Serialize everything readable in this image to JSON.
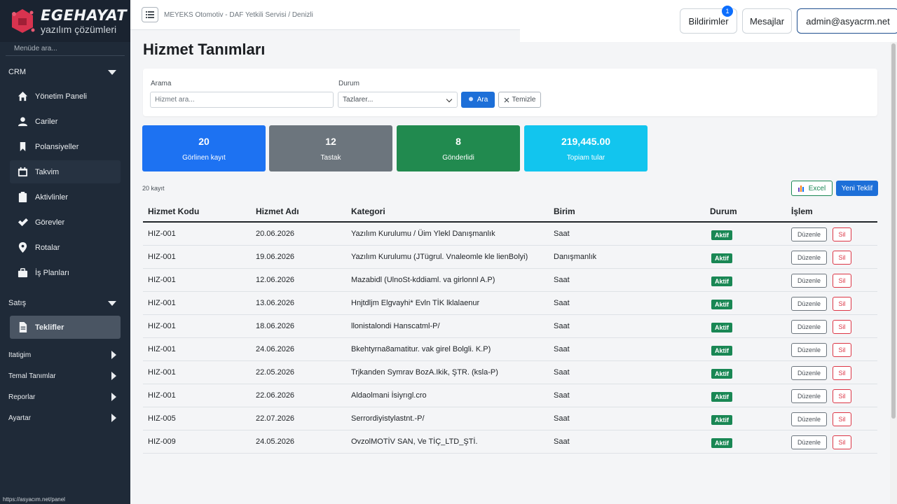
{
  "brand": {
    "name": "EGEHAYAT",
    "tagline": "yazılım çözümleri"
  },
  "topbar": {
    "breadcrumb": "MEYEKS Otomotiv - DAF Yetkili Servisi / Denizli",
    "notifications_label": "Bildirimler",
    "notifications_count": "1",
    "messages_label": "Mesajlar",
    "user_label": "admin@asyacrm.net"
  },
  "sidebar": {
    "search_placeholder": "Menüde ara...",
    "crm_title": "CRM",
    "crm_items": [
      {
        "label": "Yönetim Paneli",
        "icon": "home-icon"
      },
      {
        "label": "Cariler",
        "icon": "user-icon"
      },
      {
        "label": "Polansiyeller",
        "icon": "bookmark-icon"
      },
      {
        "label": "Takvim",
        "icon": "calendar-icon"
      },
      {
        "label": "Aktivlinler",
        "icon": "clipboard-icon"
      },
      {
        "label": "Görevler",
        "icon": "check-icon"
      },
      {
        "label": "Rotalar",
        "icon": "map-pin-icon"
      },
      {
        "label": "İş Planları",
        "icon": "briefcase-icon"
      }
    ],
    "sales_title": "Satış",
    "sales_items": [
      {
        "label": "Teklifler",
        "icon": "document-icon"
      }
    ],
    "collapsed_sections": [
      "Itatigim",
      "Temal Tanımlar",
      "Reporlar",
      "Ayartar"
    ],
    "status_url": "https://asyacım.net/panel"
  },
  "page": {
    "title": "Hizmet Tanımları"
  },
  "filters": {
    "search_label": "Arama",
    "search_placeholder": "Hizmet ara...",
    "status_label": "Durum",
    "status_value": "Tazlarer...",
    "search_button": "Ara",
    "clear_button": "Temizle"
  },
  "stats": [
    {
      "value": "20",
      "label": "Görlinen kayıt",
      "color": "#1d72f2"
    },
    {
      "value": "12",
      "label": "Tastak",
      "color": "#6c757d"
    },
    {
      "value": "8",
      "label": "Gönderlidi",
      "color": "#218a4f"
    },
    {
      "value": "219,445.00",
      "label": "Topiam tular",
      "color": "#12c5ee"
    }
  ],
  "record_count": "20 kayıt",
  "actions": {
    "excel": "Excel",
    "new": "Yeni Teklif"
  },
  "table": {
    "headers": [
      "Hizmet Kodu",
      "Hizmet Adı",
      "Kategori",
      "Birim",
      "Durum",
      "İşlem"
    ],
    "edit_label": "Düzenle",
    "delete_label": "Sil",
    "rows": [
      {
        "code": "HIZ-001",
        "date": "20.06.2026",
        "category": "Yazılım Kurulumu / Üim Ylekl Danışmanlık",
        "unit": "Saat",
        "status": "Aktif"
      },
      {
        "code": "HIZ-001",
        "date": "19.06.2026",
        "category": "Yazılım Kurulumu (JTügrul. Vnaleomle kle lienBolyi)",
        "unit": "Danışmanlık",
        "status": "Aktif"
      },
      {
        "code": "HIZ-001",
        "date": "12.06.2026",
        "category": "Mazabidl (UlnoSt-kddiaml. va girlonnl A.P)",
        "unit": "Saat",
        "status": "Aktif"
      },
      {
        "code": "HIZ-001",
        "date": "13.06.2026",
        "category": "Hnjtdljm Elgvayhi* Evln TİK lklalaenur",
        "unit": "Saat",
        "status": "Aktif"
      },
      {
        "code": "HIZ-001",
        "date": "18.06.2026",
        "category": "llonistalondi Hanscatml-P/",
        "unit": "Saat",
        "status": "Aktif"
      },
      {
        "code": "HIZ-001",
        "date": "24.06.2026",
        "category": "Bkehtyrna8amatitur. vak girel Bolgli. K.P)",
        "unit": "Saat",
        "status": "Aktif"
      },
      {
        "code": "HIZ-001",
        "date": "22.05.2026",
        "category": "Trjkanden Symrav BozA.Ikik, ŞTR. (ksla-P)",
        "unit": "Saat",
        "status": "Aktif"
      },
      {
        "code": "HIZ-001",
        "date": "22.06.2026",
        "category": "Aldaolmani İsiyrıgl.cro",
        "unit": "Saat",
        "status": "Aktif"
      },
      {
        "code": "HIZ-005",
        "date": "22.07.2026",
        "category": "Serrordiyistylastnt.-P/",
        "unit": "Saat",
        "status": "Aktif"
      },
      {
        "code": "HIZ-009",
        "date": "24.05.2026",
        "category": "OvzolMOTİV SAN, Ve TİÇ_LTD_ŞTİ.",
        "unit": "Saat",
        "status": "Aktif"
      }
    ]
  }
}
